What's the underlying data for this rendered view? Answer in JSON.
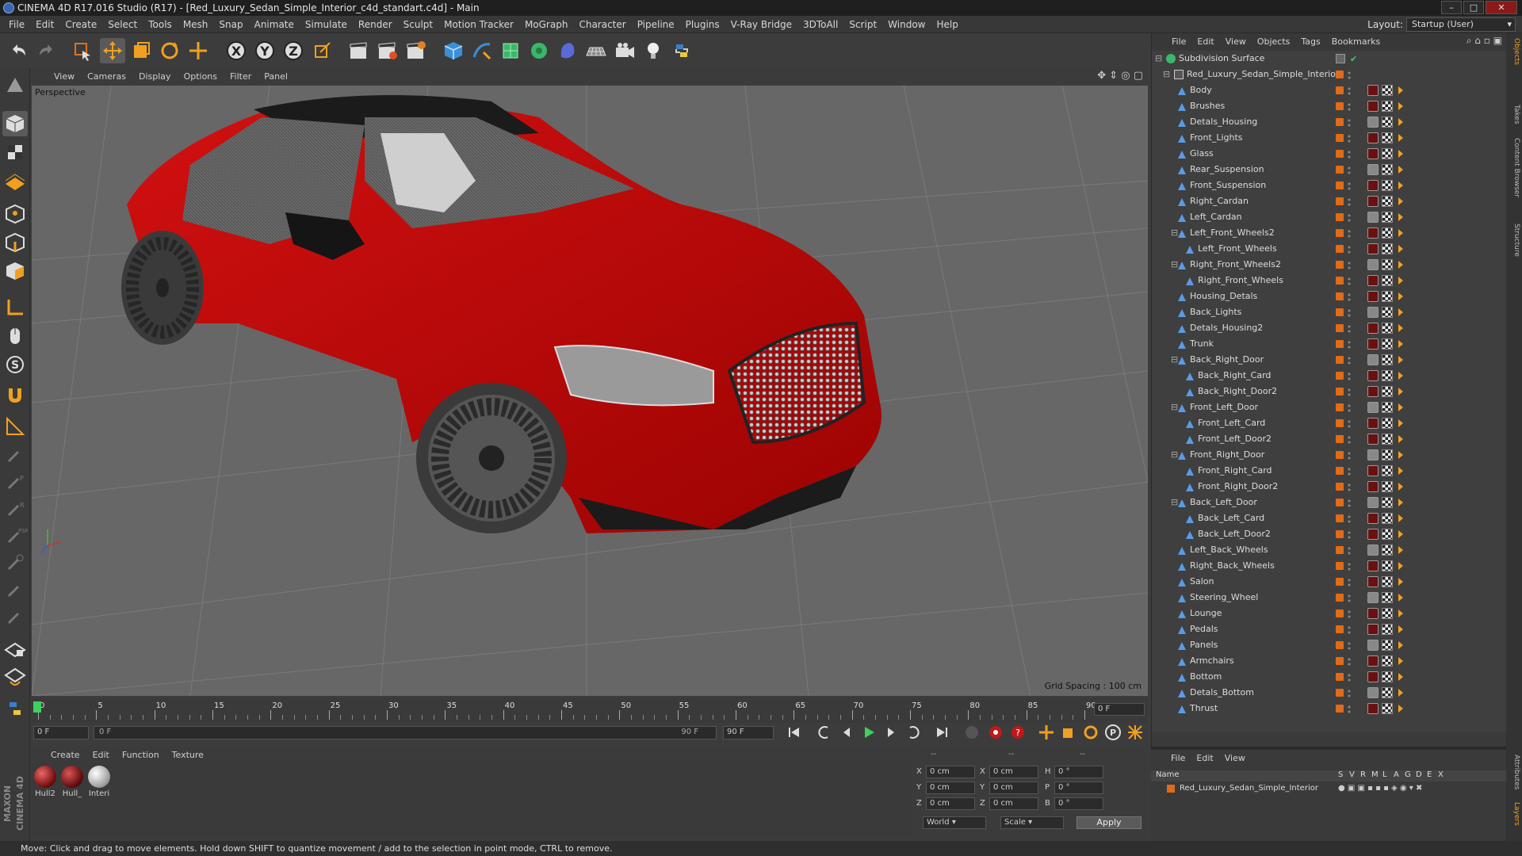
{
  "window": {
    "title": "CINEMA 4D R17.016 Studio (R17) - [Red_Luxury_Sedan_Simple_Interior_c4d_standart.c4d] - Main"
  },
  "menubar": {
    "items": [
      "File",
      "Edit",
      "Create",
      "Select",
      "Tools",
      "Mesh",
      "Snap",
      "Animate",
      "Simulate",
      "Render",
      "Sculpt",
      "Motion Tracker",
      "MoGraph",
      "Character",
      "Pipeline",
      "Plugins",
      "V-Ray Bridge",
      "3DToAll",
      "Script",
      "Window",
      "Help"
    ],
    "layout_label": "Layout:",
    "layout_value": "Startup (User)"
  },
  "viewport": {
    "menu": [
      "View",
      "Cameras",
      "Display",
      "Options",
      "Filter",
      "Panel"
    ],
    "camera_label": "Perspective",
    "grid_spacing": "Grid Spacing : 100 cm"
  },
  "timeline": {
    "ticks": [
      "0",
      "5",
      "10",
      "15",
      "20",
      "25",
      "30",
      "35",
      "40",
      "45",
      "50",
      "55",
      "60",
      "65",
      "70",
      "75",
      "80",
      "85",
      "90"
    ],
    "current_frame": "0 F",
    "start_field": "0 F",
    "range_start": "0 F",
    "range_end": "90 F",
    "end_field": "90 F"
  },
  "materials": {
    "menu": [
      "Create",
      "Edit",
      "Function",
      "Texture"
    ],
    "items": [
      "Hull2",
      "Hull_",
      "Interi"
    ]
  },
  "coords": {
    "header": [
      "--",
      "--",
      "--"
    ],
    "rows": [
      {
        "a": "X",
        "av": "0 cm",
        "b": "X",
        "bv": "0 cm",
        "c": "H",
        "cv": "0 °"
      },
      {
        "a": "Y",
        "av": "0 cm",
        "b": "Y",
        "bv": "0 cm",
        "c": "P",
        "cv": "0 °"
      },
      {
        "a": "Z",
        "av": "0 cm",
        "b": "Z",
        "bv": "0 cm",
        "c": "B",
        "cv": "0 °"
      }
    ],
    "world": "World",
    "scale": "Scale",
    "apply": "Apply"
  },
  "objects": {
    "menu": [
      "File",
      "Edit",
      "View",
      "Objects",
      "Tags",
      "Bookmarks"
    ],
    "root": "Subdivision Surface",
    "group": "Red_Luxury_Sedan_Simple_Interior",
    "items": [
      {
        "name": "Body",
        "level": 0,
        "fold": false
      },
      {
        "name": "Brushes",
        "level": 0,
        "fold": false
      },
      {
        "name": "Detals_Housing",
        "level": 0,
        "fold": false
      },
      {
        "name": "Front_Lights",
        "level": 0,
        "fold": false
      },
      {
        "name": "Glass",
        "level": 0,
        "fold": false
      },
      {
        "name": "Rear_Suspension",
        "level": 0,
        "fold": false
      },
      {
        "name": "Front_Suspension",
        "level": 0,
        "fold": false
      },
      {
        "name": "Right_Cardan",
        "level": 0,
        "fold": false
      },
      {
        "name": "Left_Cardan",
        "level": 0,
        "fold": false
      },
      {
        "name": "Left_Front_Wheels2",
        "level": 0,
        "fold": true
      },
      {
        "name": "Left_Front_Wheels",
        "level": 1,
        "fold": false
      },
      {
        "name": "Right_Front_Wheels2",
        "level": 0,
        "fold": true
      },
      {
        "name": "Right_Front_Wheels",
        "level": 1,
        "fold": false
      },
      {
        "name": "Housing_Detals",
        "level": 0,
        "fold": false
      },
      {
        "name": "Back_Lights",
        "level": 0,
        "fold": false
      },
      {
        "name": "Detals_Housing2",
        "level": 0,
        "fold": false
      },
      {
        "name": "Trunk",
        "level": 0,
        "fold": false
      },
      {
        "name": "Back_Right_Door",
        "level": 0,
        "fold": true
      },
      {
        "name": "Back_Right_Card",
        "level": 1,
        "fold": false
      },
      {
        "name": "Back_Right_Door2",
        "level": 1,
        "fold": false
      },
      {
        "name": "Front_Left_Door",
        "level": 0,
        "fold": true
      },
      {
        "name": "Front_Left_Card",
        "level": 1,
        "fold": false
      },
      {
        "name": "Front_Left_Door2",
        "level": 1,
        "fold": false
      },
      {
        "name": "Front_Right_Door",
        "level": 0,
        "fold": true
      },
      {
        "name": "Front_Right_Card",
        "level": 1,
        "fold": false
      },
      {
        "name": "Front_Right_Door2",
        "level": 1,
        "fold": false
      },
      {
        "name": "Back_Left_Door",
        "level": 0,
        "fold": true
      },
      {
        "name": "Back_Left_Card",
        "level": 1,
        "fold": false
      },
      {
        "name": "Back_Left_Door2",
        "level": 1,
        "fold": false
      },
      {
        "name": "Left_Back_Wheels",
        "level": 0,
        "fold": false
      },
      {
        "name": "Right_Back_Wheels",
        "level": 0,
        "fold": false
      },
      {
        "name": "Salon",
        "level": 0,
        "fold": false
      },
      {
        "name": "Steering_Wheel",
        "level": 0,
        "fold": false
      },
      {
        "name": "Lounge",
        "level": 0,
        "fold": false
      },
      {
        "name": "Pedals",
        "level": 0,
        "fold": false
      },
      {
        "name": "Panels",
        "level": 0,
        "fold": false
      },
      {
        "name": "Armchairs",
        "level": 0,
        "fold": false
      },
      {
        "name": "Bottom",
        "level": 0,
        "fold": false
      },
      {
        "name": "Detals_Bottom",
        "level": 0,
        "fold": false
      },
      {
        "name": "Thrust",
        "level": 0,
        "fold": false
      }
    ]
  },
  "layers": {
    "menu": [
      "File",
      "Edit",
      "View"
    ],
    "col_name": "Name",
    "cols": [
      "S",
      "V",
      "R",
      "M",
      "L",
      "A",
      "G",
      "D",
      "E",
      "X"
    ],
    "row": "Red_Luxury_Sedan_Simple_Interior"
  },
  "right_tabs": [
    "Objects",
    "Takes",
    "Content Browser",
    "Structure",
    "Attributes",
    "Layers"
  ],
  "status": "Move: Click and drag to move elements. Hold down SHIFT to quantize movement / add to the selection in point mode, CTRL to remove.",
  "colors": {
    "car_red": "#c00606",
    "accent_orange": "#e06b18",
    "viewport_bg": "#676767"
  }
}
